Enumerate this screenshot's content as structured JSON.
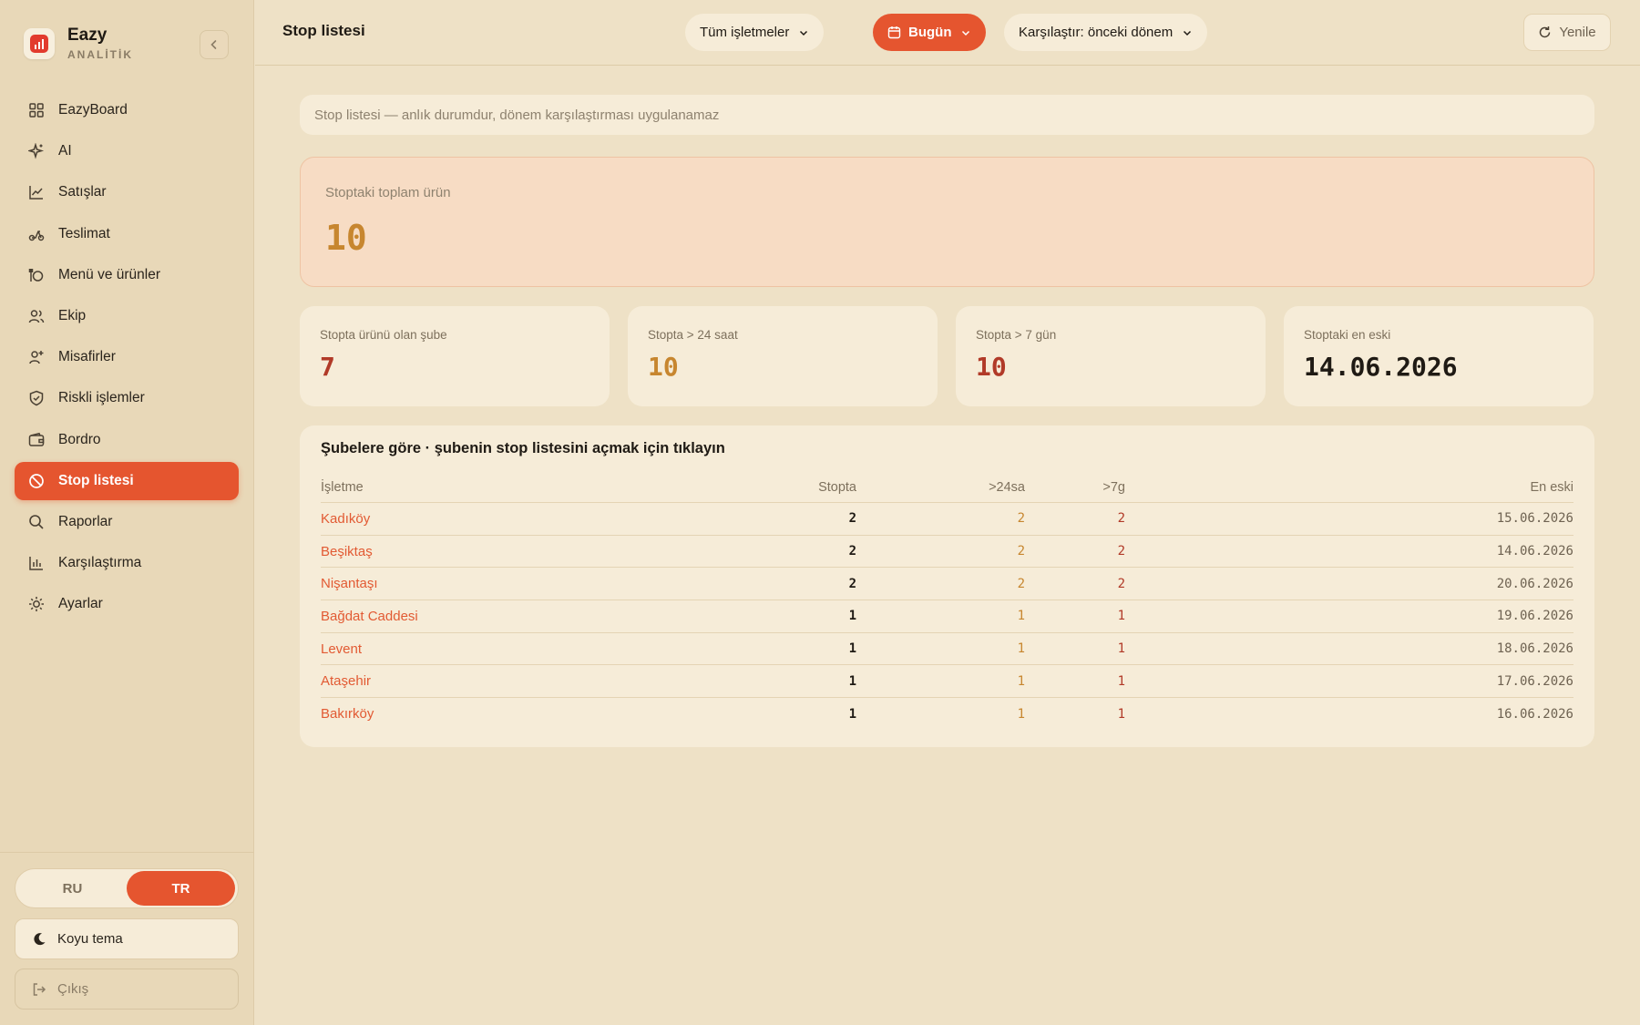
{
  "brand": {
    "name": "Eazy",
    "sub": "ANALİTİK"
  },
  "sidebar": {
    "items": [
      {
        "label": "EazyBoard",
        "icon": "grid-icon"
      },
      {
        "label": "AI",
        "icon": "sparkle-icon"
      },
      {
        "label": "Satışlar",
        "icon": "chart-line-icon"
      },
      {
        "label": "Teslimat",
        "icon": "scooter-icon"
      },
      {
        "label": "Menü ve ürünler",
        "icon": "menu-food-icon"
      },
      {
        "label": "Ekip",
        "icon": "users-icon"
      },
      {
        "label": "Misafirler",
        "icon": "user-plus-icon"
      },
      {
        "label": "Riskli işlemler",
        "icon": "shield-check-icon"
      },
      {
        "label": "Bordro",
        "icon": "wallet-icon"
      },
      {
        "label": "Stop listesi",
        "icon": "ban-icon",
        "active": true
      },
      {
        "label": "Raporlar",
        "icon": "search-icon"
      },
      {
        "label": "Karşılaştırma",
        "icon": "bar-chart-icon"
      },
      {
        "label": "Ayarlar",
        "icon": "sun-gear-icon"
      }
    ],
    "lang": {
      "ru": "RU",
      "tr": "TR",
      "selected": "TR"
    },
    "theme_label": "Koyu tema",
    "logout_label": "Çıkış"
  },
  "header": {
    "title": "Stop listesi",
    "business_filter": "Tüm işletmeler",
    "date_filter": "Bugün",
    "compare_filter": "Karşılaştır: önceki dönem",
    "refresh_label": "Yenile"
  },
  "notice": "Stop listesi — anlık durumdur, dönem karşılaştırması uygulanamaz",
  "hero": {
    "label": "Stoptaki toplam ürün",
    "value": "10"
  },
  "cards": [
    {
      "label": "Stopta ürünü olan şube",
      "value": "7",
      "color": "#b13a28"
    },
    {
      "label": "Stopta > 24 saat",
      "value": "10",
      "color": "#c7862f"
    },
    {
      "label": "Stopta > 7 gün",
      "value": "10",
      "color": "#b13a28"
    },
    {
      "label": "Stoptaki en eski",
      "value": "14.06.2026",
      "color": "#1f1a14"
    }
  ],
  "table": {
    "title": "Şubelere göre · şubenin stop listesini açmak için tıklayın",
    "columns": [
      "İşletme",
      "Stopta",
      ">24sa",
      ">7g",
      "En eski"
    ],
    "rows": [
      {
        "name": "Kadıköy",
        "stop": "2",
        "h24": "2",
        "d7": "2",
        "oldest": "15.06.2026"
      },
      {
        "name": "Beşiktaş",
        "stop": "2",
        "h24": "2",
        "d7": "2",
        "oldest": "14.06.2026"
      },
      {
        "name": "Nişantaşı",
        "stop": "2",
        "h24": "2",
        "d7": "2",
        "oldest": "20.06.2026"
      },
      {
        "name": "Bağdat Caddesi",
        "stop": "1",
        "h24": "1",
        "d7": "1",
        "oldest": "19.06.2026"
      },
      {
        "name": "Levent",
        "stop": "1",
        "h24": "1",
        "d7": "1",
        "oldest": "18.06.2026"
      },
      {
        "name": "Ataşehir",
        "stop": "1",
        "h24": "1",
        "d7": "1",
        "oldest": "17.06.2026"
      },
      {
        "name": "Bakırköy",
        "stop": "1",
        "h24": "1",
        "d7": "1",
        "oldest": "16.06.2026"
      }
    ]
  },
  "colors": {
    "accent": "#e5552f",
    "amber": "#c7862f",
    "red": "#b13a28"
  }
}
